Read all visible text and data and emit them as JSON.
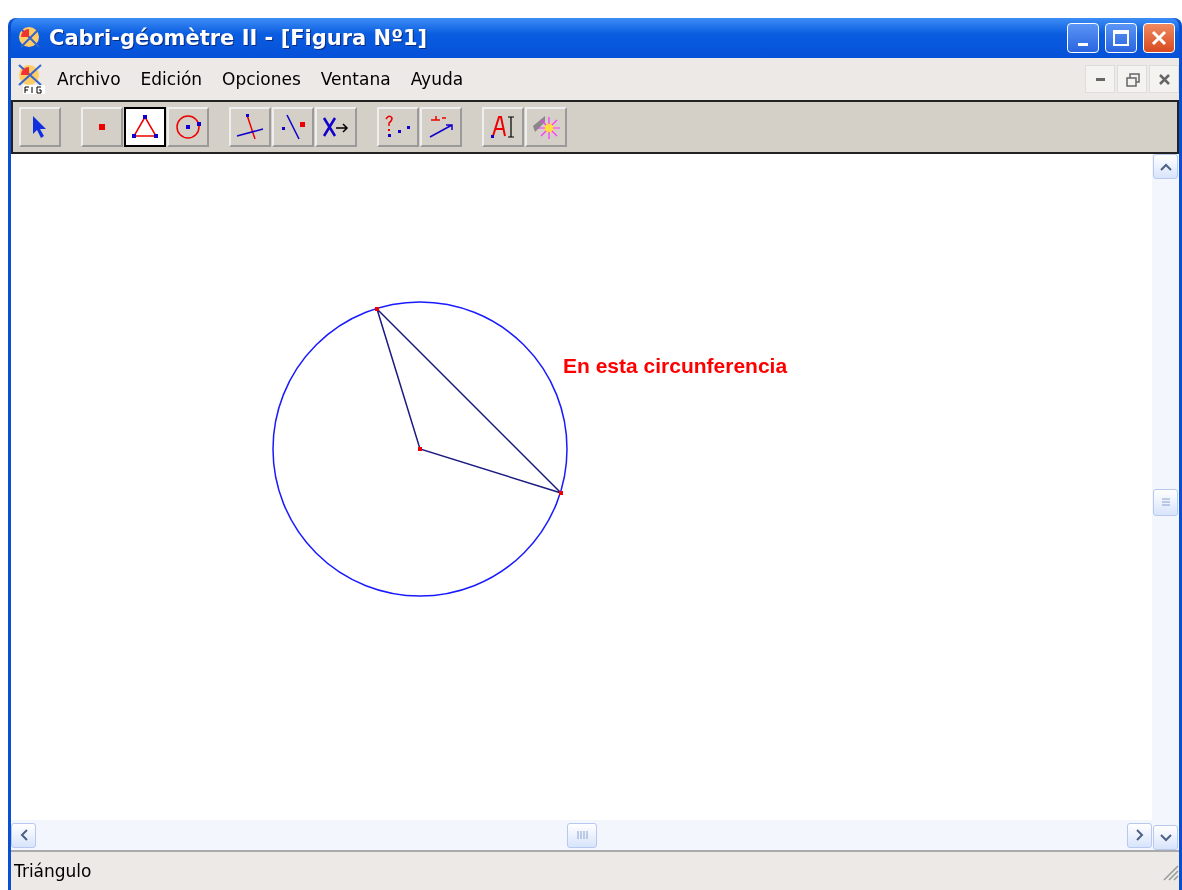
{
  "window": {
    "title": "Cabri-géomètre II - [Figura Nº1]"
  },
  "menu": [
    "Archivo",
    "Edición",
    "Opciones",
    "Ventana",
    "Ayuda"
  ],
  "toolbar": {
    "groups": [
      [
        {
          "kind": "pointer",
          "selected": false
        }
      ],
      [
        {
          "kind": "point",
          "selected": false
        },
        {
          "kind": "triangle",
          "selected": true
        },
        {
          "kind": "circle",
          "selected": false
        }
      ],
      [
        {
          "kind": "lines",
          "selected": false
        },
        {
          "kind": "perpendicular",
          "selected": false
        },
        {
          "kind": "transform",
          "selected": false
        }
      ],
      [
        {
          "kind": "check",
          "selected": false
        },
        {
          "kind": "measure",
          "selected": false
        }
      ],
      [
        {
          "kind": "text",
          "selected": false
        },
        {
          "kind": "display",
          "selected": false
        }
      ]
    ]
  },
  "canvas": {
    "label": "En esta circunferencia"
  },
  "status_bar": "Triángulo"
}
